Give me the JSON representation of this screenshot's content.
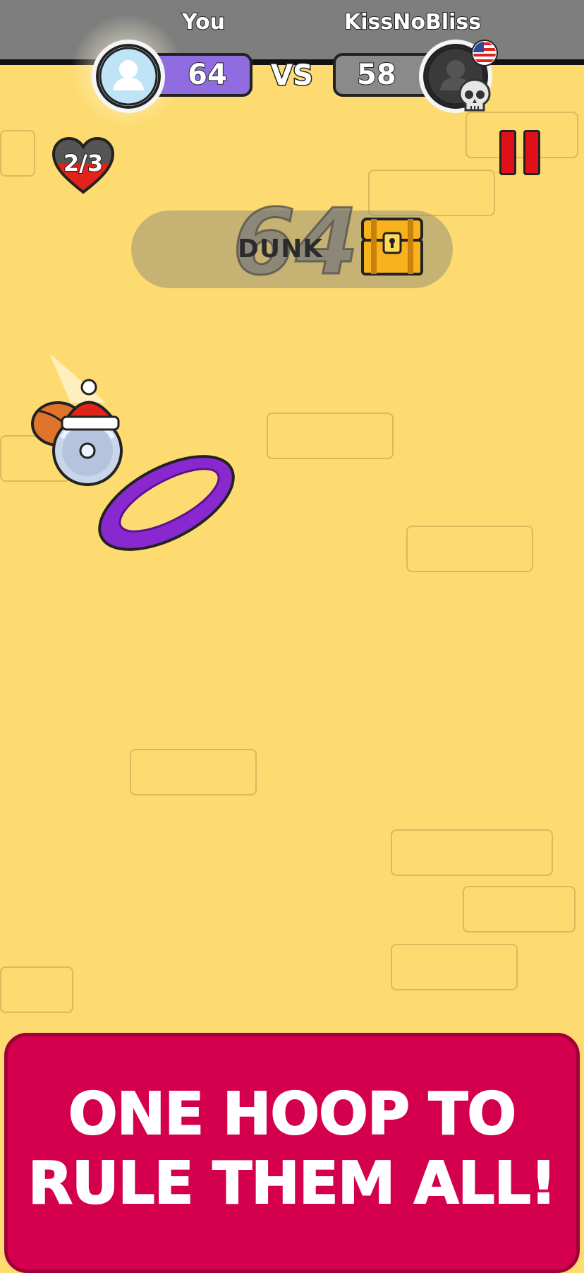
{
  "player": {
    "name": "You",
    "score": "64"
  },
  "versus": "VS",
  "opponent": {
    "name": "KissNoBliss",
    "score": "58",
    "flag": "us-flag"
  },
  "lives": "2/3",
  "banner": {
    "word": "DUNK",
    "counter": "64"
  },
  "promo": {
    "line1": "ONE HOOP TO",
    "line2": "RULE THEM ALL!"
  },
  "colors": {
    "background": "#fedb71",
    "player_pill": "#8f6ce0",
    "opponent_pill": "#8a8a8a",
    "hoop": "#8a28d0",
    "promo_panel": "#d4004e",
    "pause": "#e0101a"
  }
}
